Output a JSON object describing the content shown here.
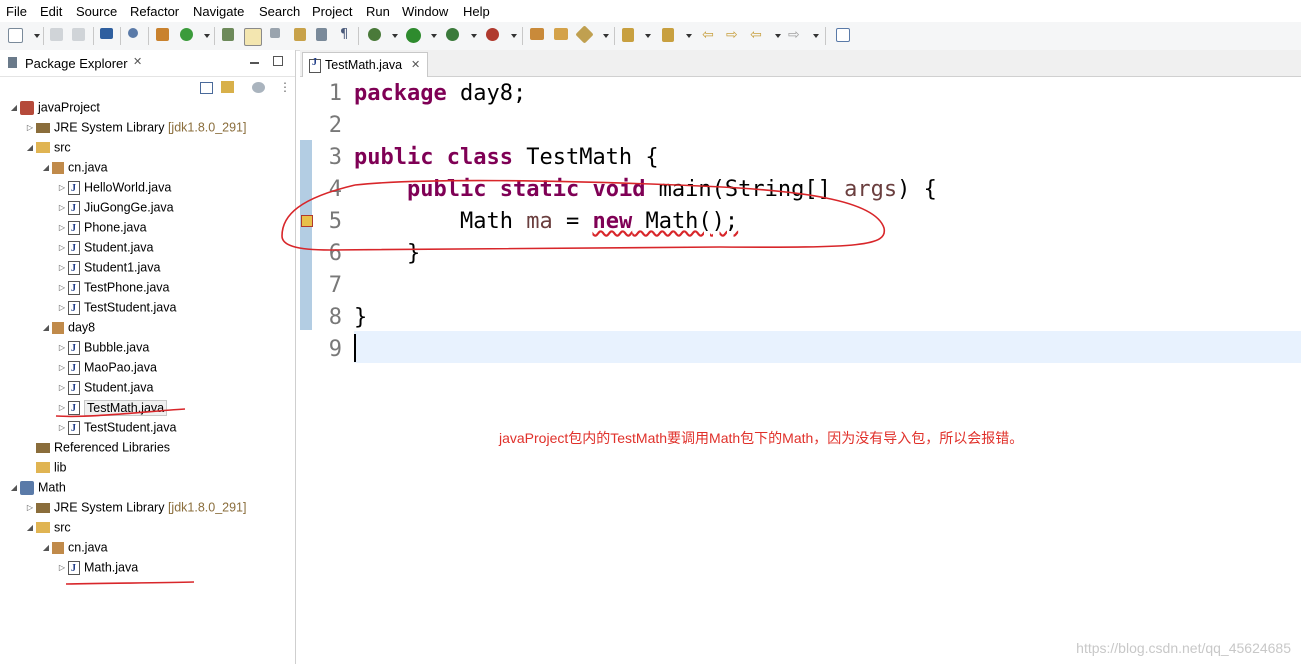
{
  "menu": [
    "File",
    "Edit",
    "Source",
    "Refactor",
    "Navigate",
    "Search",
    "Project",
    "Run",
    "Window",
    "Help"
  ],
  "package_explorer": {
    "title": "Package Explorer",
    "close_glyph": "✕",
    "tree": [
      {
        "label": "javaProject",
        "sub": "",
        "icon": "project-icon",
        "arrow": "◢"
      },
      {
        "label": "JRE System Library",
        "sub": "[jdk1.8.0_291]",
        "icon": "library-icon",
        "arrow": "▷"
      },
      {
        "label": "src",
        "sub": "",
        "icon": "source-folder-icon",
        "arrow": "◢"
      },
      {
        "label": "cn.java",
        "sub": "",
        "icon": "package-icon",
        "arrow": "◢"
      },
      {
        "label": "HelloWorld.java",
        "sub": "",
        "icon": "java-file-icon",
        "arrow": "▷"
      },
      {
        "label": "JiuGongGe.java",
        "sub": "",
        "icon": "java-file-icon",
        "arrow": "▷"
      },
      {
        "label": "Phone.java",
        "sub": "",
        "icon": "java-file-icon",
        "arrow": "▷"
      },
      {
        "label": "Student.java",
        "sub": "",
        "icon": "java-file-icon",
        "arrow": "▷"
      },
      {
        "label": "Student1.java",
        "sub": "",
        "icon": "java-file-icon",
        "arrow": "▷"
      },
      {
        "label": "TestPhone.java",
        "sub": "",
        "icon": "java-file-icon",
        "arrow": "▷"
      },
      {
        "label": "TestStudent.java",
        "sub": "",
        "icon": "java-file-icon",
        "arrow": "▷"
      },
      {
        "label": "day8",
        "sub": "",
        "icon": "package-icon",
        "arrow": "◢"
      },
      {
        "label": "Bubble.java",
        "sub": "",
        "icon": "java-file-icon",
        "arrow": "▷"
      },
      {
        "label": "MaoPao.java",
        "sub": "",
        "icon": "java-file-icon",
        "arrow": "▷"
      },
      {
        "label": "Student.java",
        "sub": "",
        "icon": "java-file-icon",
        "arrow": "▷"
      },
      {
        "label": "TestMath.java",
        "sub": "",
        "icon": "java-file-icon",
        "arrow": "▷"
      },
      {
        "label": "TestStudent.java",
        "sub": "",
        "icon": "java-file-icon",
        "arrow": "▷"
      },
      {
        "label": "Referenced Libraries",
        "sub": "",
        "icon": "library-icon",
        "arrow": ""
      },
      {
        "label": "lib",
        "sub": "",
        "icon": "folder-icon",
        "arrow": ""
      },
      {
        "label": "Math",
        "sub": "",
        "icon": "project-icon",
        "arrow": "◢"
      },
      {
        "label": "JRE System Library",
        "sub": "[jdk1.8.0_291]",
        "icon": "library-icon",
        "arrow": "▷"
      },
      {
        "label": "src",
        "sub": "",
        "icon": "source-folder-icon",
        "arrow": "◢"
      },
      {
        "label": "cn.java",
        "sub": "",
        "icon": "package-icon",
        "arrow": "◢"
      },
      {
        "label": "Math.java",
        "sub": "",
        "icon": "java-file-icon",
        "arrow": "▷"
      }
    ]
  },
  "editor": {
    "tab_label": "TestMath.java",
    "close_glyph": "✕",
    "line_numbers": [
      "1",
      "2",
      "3",
      "4",
      "5",
      "6",
      "7",
      "8",
      "9"
    ],
    "code": {
      "l1_kw": "package",
      "l1_rest": " day8;",
      "l3_kw1": "public",
      "l3_kw2": "class",
      "l3_rest": " TestMath {",
      "l4_indent": "    ",
      "l4_kw1": "public",
      "l4_kw2": "static",
      "l4_kw3": "void",
      "l4_rest1": " main(String[] ",
      "l4_var": "args",
      "l4_rest2": ") {",
      "l5_indent": "        ",
      "l5_type": "Math ",
      "l5_var": "ma",
      "l5_eq": " = ",
      "l5_kw": "new",
      "l5_rest": " Math();",
      "l6": "    }",
      "l8": "}"
    }
  },
  "annotation": "javaProject包内的TestMath要调用Math包下的Math，因为没有导入包，所以会报错。",
  "watermark": "https://blog.csdn.net/qq_45624685",
  "colors": {
    "keyword": "#7f0055",
    "annotation": "#e0302a",
    "ink": "#d8262a"
  }
}
